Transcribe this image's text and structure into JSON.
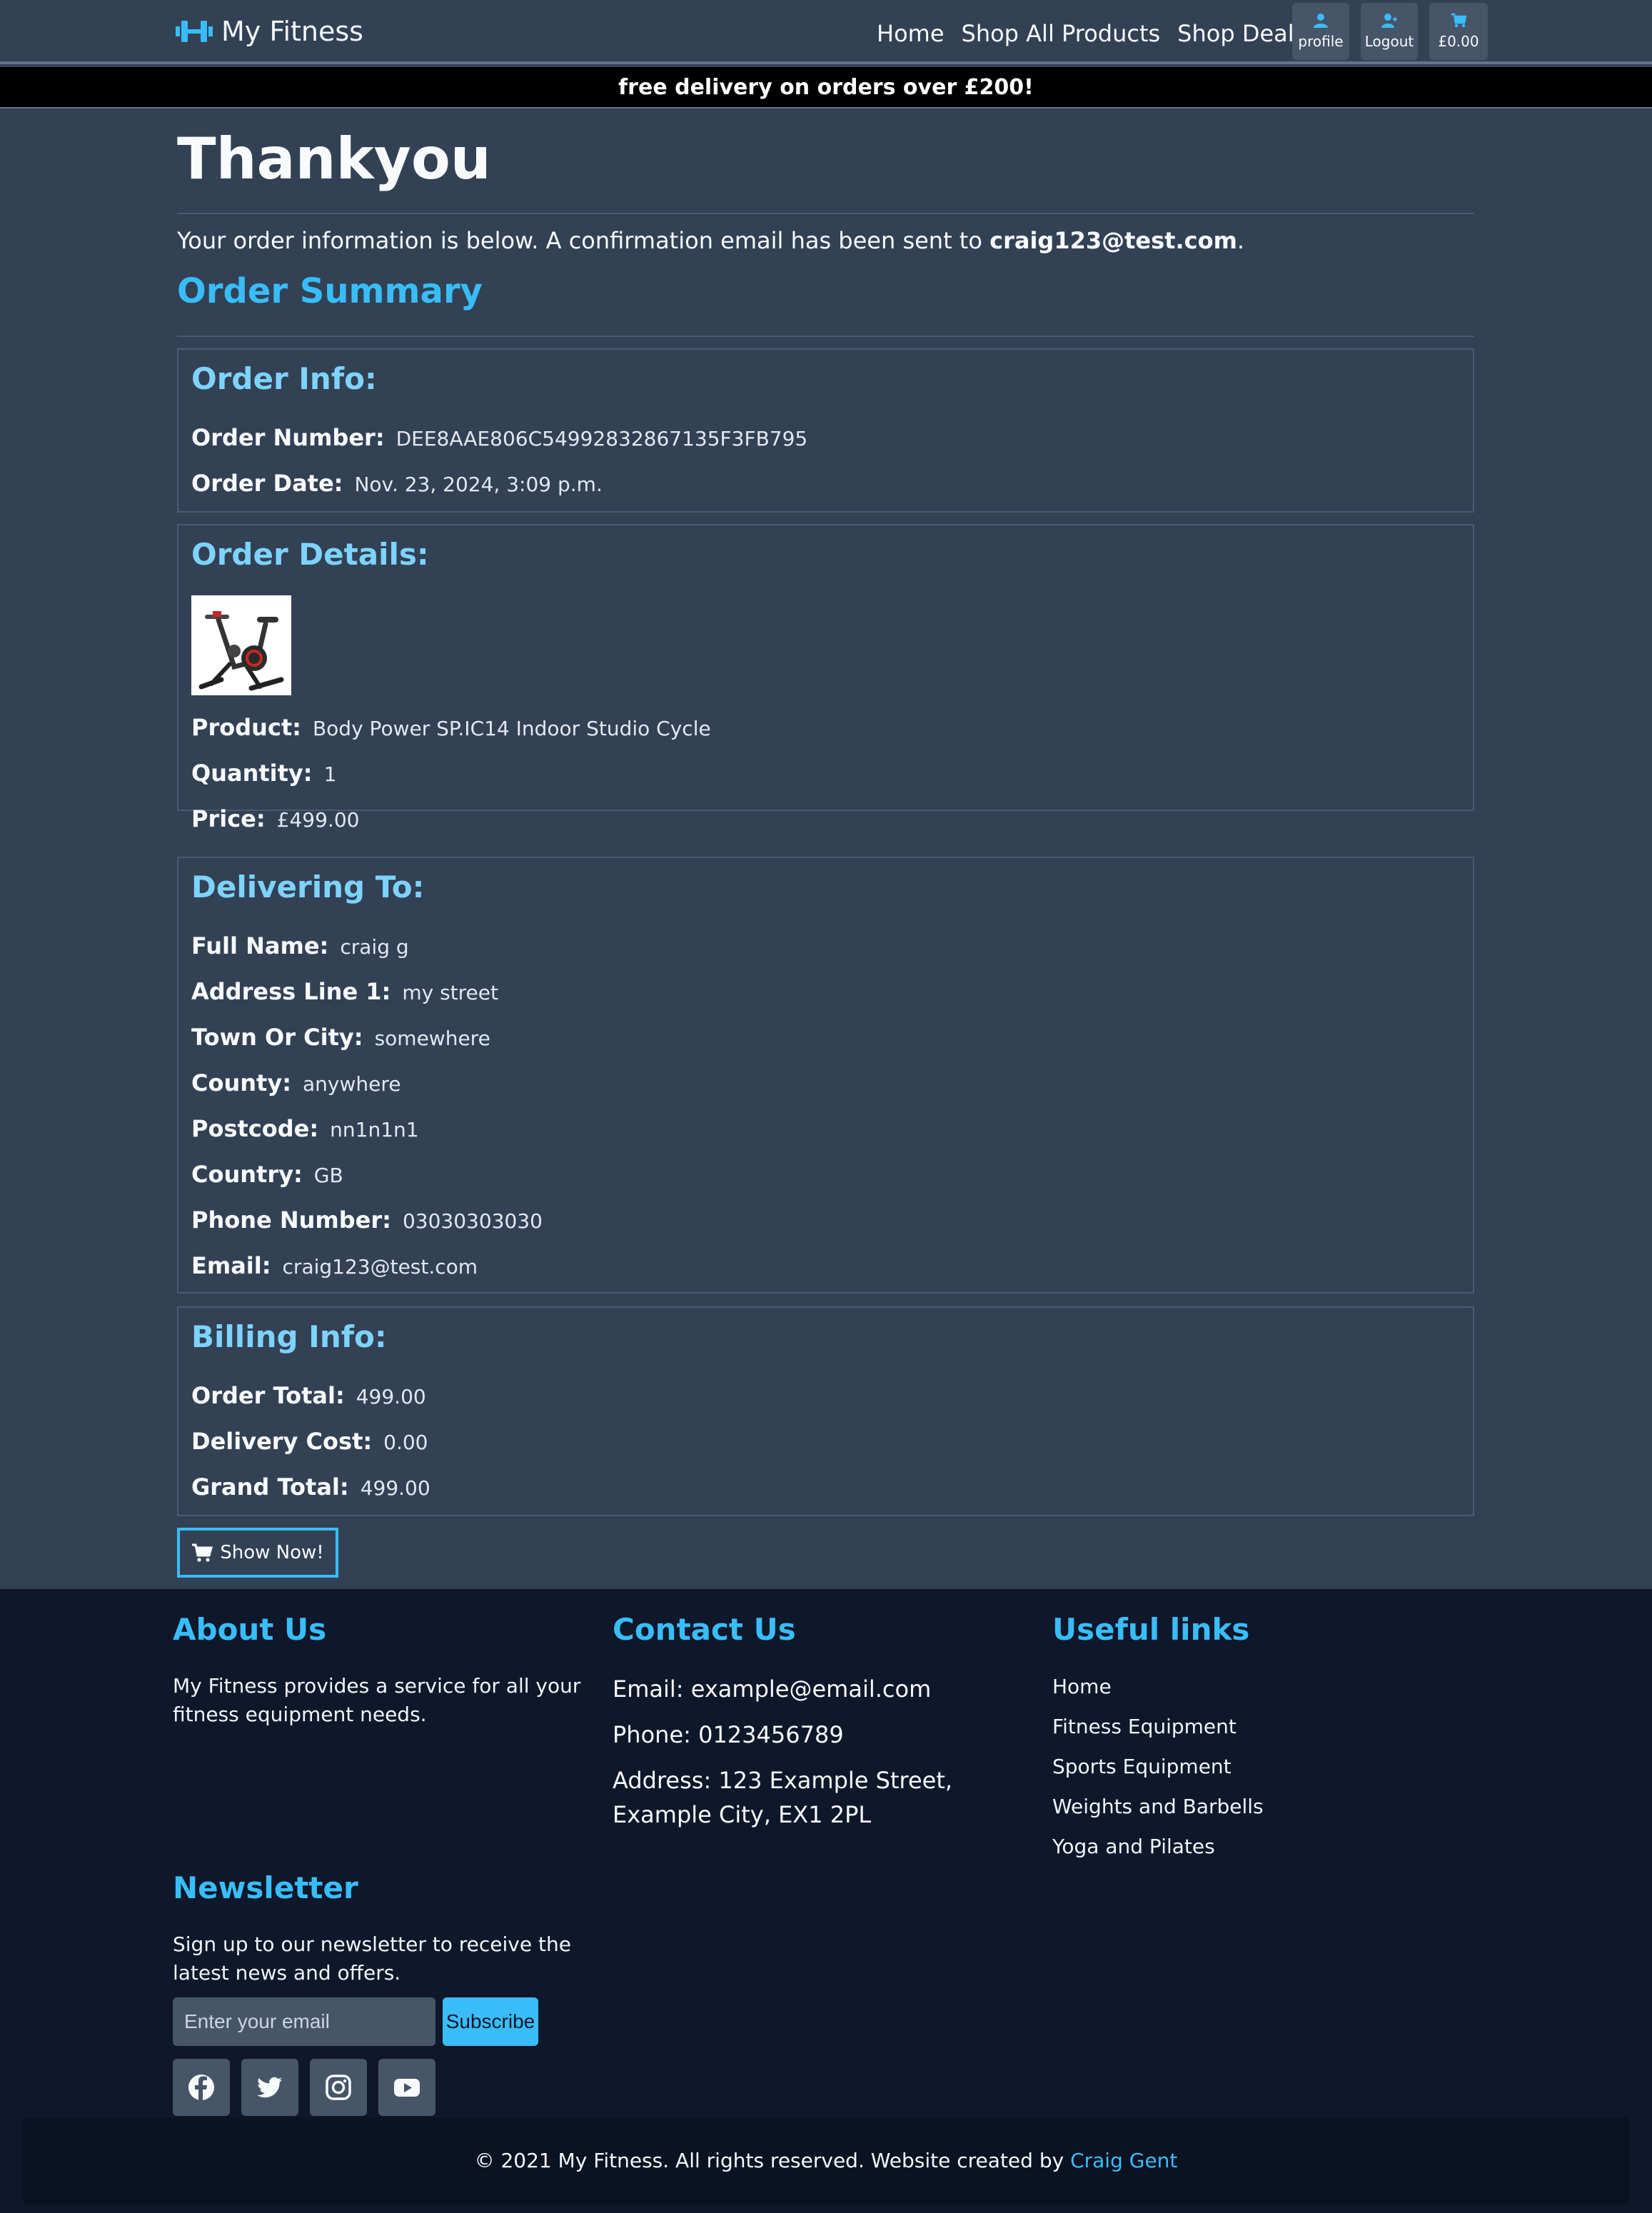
{
  "nav": {
    "brand": "My Fitness",
    "links": [
      "Home",
      "Shop All Products",
      "Shop Deals"
    ],
    "buttons": [
      {
        "icon": "user-icon",
        "label": "profile"
      },
      {
        "icon": "user-plus-icon",
        "label": "Logout"
      },
      {
        "icon": "cart-icon",
        "label": "£0.00"
      }
    ]
  },
  "banner": "free delivery on orders over £200!",
  "page": {
    "title": "Thankyou",
    "intro_prefix": "Your order information is below. A confirmation email has been sent to ",
    "intro_email": "craig123@test.com",
    "intro_suffix": ".",
    "summary_title": "Order Summary"
  },
  "order_info": {
    "title": "Order Info:",
    "fields": [
      {
        "label": "Order Number:",
        "value": "DEE8AAE806C54992832867135F3FB795"
      },
      {
        "label": "Order Date:",
        "value": "Nov. 23, 2024, 3:09 p.m."
      }
    ]
  },
  "order_details": {
    "title": "Order Details:",
    "fields": [
      {
        "label": "Product:",
        "value": "Body Power SP.IC14 Indoor Studio Cycle"
      },
      {
        "label": "Quantity:",
        "value": "1"
      },
      {
        "label": "Price:",
        "value": "£499.00"
      }
    ]
  },
  "delivering_to": {
    "title": "Delivering To:",
    "fields": [
      {
        "label": "Full Name:",
        "value": "craig g"
      },
      {
        "label": "Address Line 1:",
        "value": "my street"
      },
      {
        "label": "Town Or City:",
        "value": "somewhere"
      },
      {
        "label": "County:",
        "value": "anywhere"
      },
      {
        "label": "Postcode:",
        "value": "nn1n1n1"
      },
      {
        "label": "Country:",
        "value": "GB"
      },
      {
        "label": "Phone Number:",
        "value": "03030303030"
      },
      {
        "label": "Email:",
        "value": "craig123@test.com"
      }
    ]
  },
  "billing_info": {
    "title": "Billing Info:",
    "fields": [
      {
        "label": "Order Total:",
        "value": "499.00"
      },
      {
        "label": "Delivery Cost:",
        "value": "0.00"
      },
      {
        "label": "Grand Total:",
        "value": "499.00"
      }
    ]
  },
  "show_button": "Show Now!",
  "footer": {
    "about_title": "About Us",
    "about_text": "My Fitness provides a service for all your fitness equipment needs.",
    "contact_title": "Contact Us",
    "contact_email": "Email: example@email.com",
    "contact_phone": "Phone: 0123456789",
    "contact_address": "Address: 123 Example Street, Example City, EX1 2PL",
    "links_title": "Useful links",
    "links": [
      "Home",
      "Fitness Equipment",
      "Sports Equipment",
      "Weights and Barbells",
      "Yoga and Pilates"
    ],
    "newsletter_title": "Newsletter",
    "newsletter_text": "Sign up to our newsletter to receive the latest news and offers.",
    "newsletter_placeholder": "Enter your email",
    "subscribe_label": "Subscribe",
    "socials": [
      "facebook-icon",
      "twitter-icon",
      "instagram-icon",
      "youtube-icon"
    ],
    "copyright": "© 2021 My Fitness. All rights reserved.  Website created by ",
    "copyright_author": "Craig Gent"
  },
  "colors": {
    "background": "#334155",
    "accent": "#38bdf8",
    "footer_bg": "#0f172a",
    "banner_bg": "#000000"
  }
}
